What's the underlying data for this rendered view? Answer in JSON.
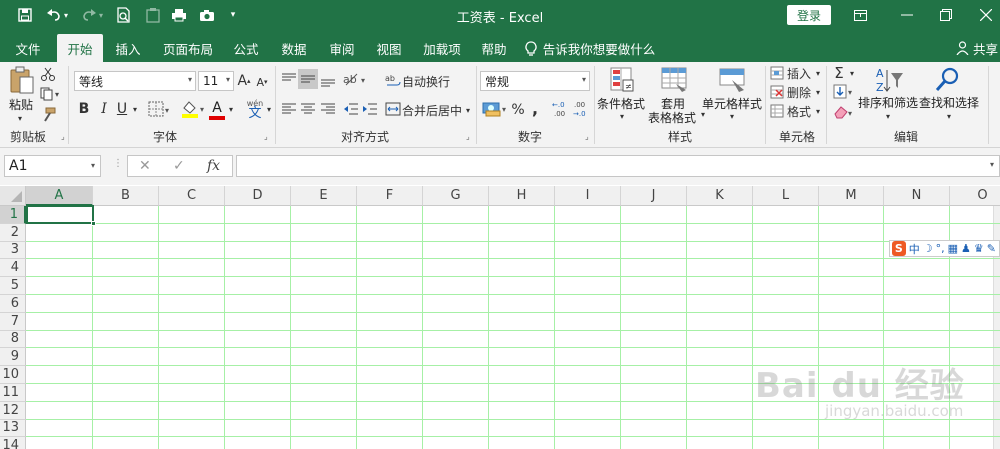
{
  "window": {
    "title": "工资表 - Excel",
    "login_label": "登录"
  },
  "tabs": [
    {
      "label": "文件"
    },
    {
      "label": "开始"
    },
    {
      "label": "插入"
    },
    {
      "label": "页面布局"
    },
    {
      "label": "公式"
    },
    {
      "label": "数据"
    },
    {
      "label": "审阅"
    },
    {
      "label": "视图"
    },
    {
      "label": "加载项"
    },
    {
      "label": "帮助"
    }
  ],
  "tell_me": "告诉我你想要做什么",
  "share_label": "共享",
  "ribbon": {
    "clipboard": {
      "label": "剪贴板",
      "paste": "粘贴"
    },
    "font": {
      "label": "字体",
      "font_name": "等线",
      "font_size": "11",
      "bold": "B",
      "italic": "I",
      "underline": "U",
      "font_color": "A",
      "grow": "A",
      "shrink": "A",
      "wen": "文",
      "wen_small": "wén"
    },
    "alignment": {
      "label": "对齐方式",
      "wrap": "自动换行",
      "merge": "合并后居中"
    },
    "number": {
      "label": "数字",
      "format": "常规",
      "percent": "%",
      "comma": ",",
      "inc_decimal": "←.0\n.00",
      "dec_decimal": ".00\n→.0"
    },
    "styles": {
      "label": "样式",
      "conditional": "条件格式",
      "table_line1": "套用",
      "table_line2": "表格格式",
      "cell_styles": "单元格样式"
    },
    "cells": {
      "label": "单元格",
      "insert": "插入",
      "delete": "删除",
      "format": "格式"
    },
    "editing": {
      "label": "编辑",
      "sort": "排序和筛选",
      "find": "查找和选择",
      "sum": "Σ"
    }
  },
  "formula_bar": {
    "name_box": "A1",
    "cancel": "✕",
    "enter": "✓",
    "fx": "fx",
    "value": ""
  },
  "grid": {
    "columns": [
      "A",
      "B",
      "C",
      "D",
      "E",
      "F",
      "G",
      "H",
      "I",
      "J",
      "K",
      "L",
      "M",
      "N",
      "O"
    ],
    "rows": [
      "1",
      "2",
      "3",
      "4",
      "5",
      "6",
      "7",
      "8",
      "9",
      "10",
      "11",
      "12",
      "13",
      "14"
    ],
    "selected_column": "A",
    "selected_row": "1"
  },
  "ime": {
    "logo": "S",
    "mode": "中"
  },
  "watermark": {
    "brand": "Bai du 经验",
    "url": "jingyan.baidu.com"
  },
  "colors": {
    "accent": "#217346",
    "gridline": "#a6f0a6"
  }
}
